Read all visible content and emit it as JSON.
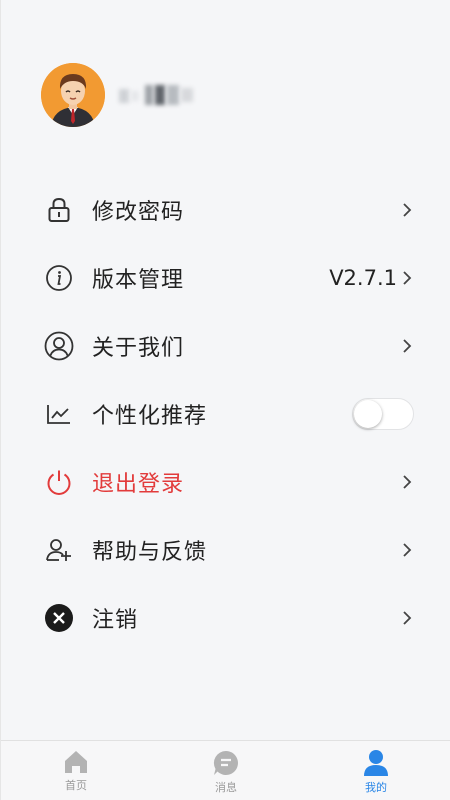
{
  "profile": {
    "avatar_alt": "avatar",
    "username_masked": true
  },
  "menu": {
    "items": [
      {
        "label": "修改密码",
        "icon": "lock-icon"
      },
      {
        "label": "版本管理",
        "icon": "info-icon",
        "value": "V2.7.1"
      },
      {
        "label": "关于我们",
        "icon": "user-circle-icon"
      },
      {
        "label": "个性化推荐",
        "icon": "chart-line-icon",
        "toggle": false
      },
      {
        "label": "退出登录",
        "icon": "power-icon"
      },
      {
        "label": "帮助与反馈",
        "icon": "add-user-icon"
      },
      {
        "label": "注销",
        "icon": "close-circle-icon"
      }
    ]
  },
  "tabbar": {
    "tabs": [
      {
        "label": "首页",
        "icon": "home-icon",
        "active": false
      },
      {
        "label": "消息",
        "icon": "message-icon",
        "active": false
      },
      {
        "label": "我的",
        "icon": "profile-icon",
        "active": true
      }
    ]
  },
  "colors": {
    "accent": "#2a86e6",
    "danger": "#e23b3b",
    "avatar_bg": "#f29a32"
  }
}
